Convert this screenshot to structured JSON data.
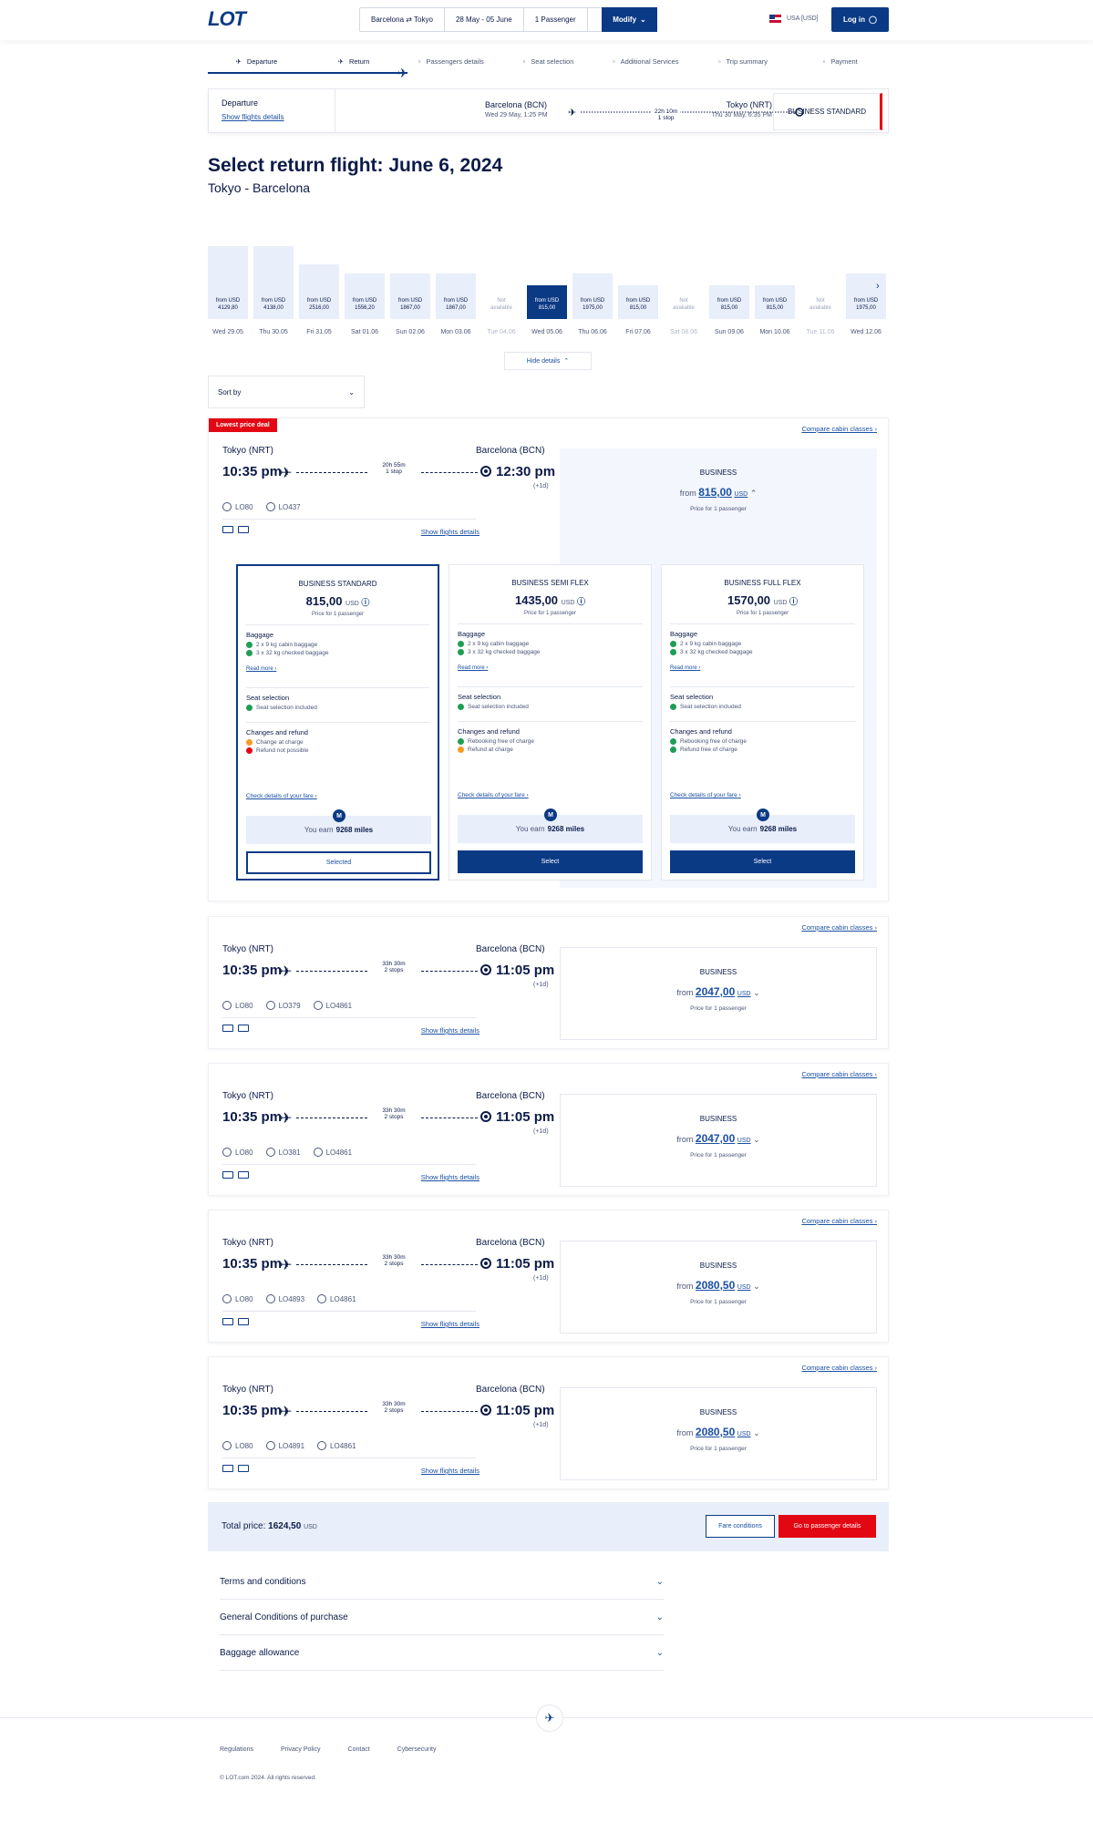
{
  "brand": {
    "logo": "LOT",
    "accent": "#0b3a85",
    "red": "#e30613"
  },
  "header": {
    "route": "Barcelona ⇄ Tokyo",
    "dates": "28 May - 05 June",
    "passengers": "1 Passenger",
    "modify": "Modify",
    "locale": "USA [USD]",
    "login": "Log in"
  },
  "steps": [
    "Departure",
    "Return",
    "Passengers details",
    "Seat selection",
    "Additional Services",
    "Trip summary",
    "Payment"
  ],
  "departure": {
    "label": "Departure",
    "link": "Show flights details",
    "from": "Barcelona (BCN)",
    "from_time": "Wed 29 May, 1:25 PM",
    "duration": "22h 10m",
    "stops": "1 stop",
    "to": "Tokyo (NRT)",
    "to_time": "Thu 30 May, 6:35 PM",
    "cabin": "BUSINESS STANDARD"
  },
  "page": {
    "title": "Select return flight: June 6, 2024",
    "subtitle": "Tokyo - Barcelona",
    "hide_details": "Hide details",
    "sort_by": "Sort by"
  },
  "dates": [
    {
      "price": "from USD\n4129,80",
      "label": "Wed 29.05",
      "h": 0.89
    },
    {
      "price": "from USD\n4138,00",
      "label": "Thu 30.05",
      "h": 0.89
    },
    {
      "price": "from USD\n2516,00",
      "label": "Fri 31.05",
      "h": 0.67
    },
    {
      "price": "from USD\n1556,20",
      "label": "Sat 01.06",
      "h": 0.56
    },
    {
      "price": "from USD\n1867,00",
      "label": "Sun 02.06",
      "h": 0.56
    },
    {
      "price": "from USD\n1867,00",
      "label": "Mon 03.06",
      "h": 0.56
    },
    {
      "price": "Not\navailable",
      "label": "Tue 04.06",
      "na": true,
      "h": 0.3
    },
    {
      "price": "from USD\n815,00",
      "label": "Wed 05.06",
      "sel": true,
      "h": 0.41
    },
    {
      "price": "from USD\n1975,00",
      "label": "Thu 06.06",
      "h": 0.56
    },
    {
      "price": "from USD\n815,00",
      "label": "Fri 07.06",
      "h": 0.41
    },
    {
      "price": "Not\navailable",
      "label": "Sat 08.06",
      "na": true,
      "h": 0.3
    },
    {
      "price": "from USD\n815,00",
      "label": "Sun 09.06",
      "h": 0.41
    },
    {
      "price": "from USD\n815,00",
      "label": "Mon 10.06",
      "h": 0.41
    },
    {
      "price": "Not\navailable",
      "label": "Tue 11.06",
      "na": true,
      "h": 0.3
    },
    {
      "price": "from USD\n1975,00",
      "label": "Wed 12.06",
      "h": 0.56
    }
  ],
  "flights": [
    {
      "lowest": "Lowest price deal",
      "from": "Tokyo (NRT)",
      "to": "Barcelona (BCN)",
      "dep": "10:35 pm",
      "arr": "12:30 pm",
      "plus": "(+1d)",
      "dur": "20h 55m",
      "stops": "1 stop",
      "nums": [
        "LO80",
        "LO437"
      ],
      "cabin": "BUSINESS",
      "price": "815,00",
      "cur": "USD",
      "pp": "Price for 1 passenger",
      "compare": "Compare cabin classes",
      "show": "Show flights details"
    },
    {
      "from": "Tokyo (NRT)",
      "to": "Barcelona (BCN)",
      "dep": "10:35 pm",
      "arr": "11:05 pm",
      "plus": "(+1d)",
      "dur": "33h 30m",
      "stops": "2 stops",
      "nums": [
        "LO80",
        "LO379",
        "LO4861"
      ],
      "cabin": "BUSINESS",
      "price": "2047,00",
      "cur": "USD",
      "pp": "Price for 1 passenger",
      "compare": "Compare cabin classes",
      "show": "Show flights details"
    },
    {
      "from": "Tokyo (NRT)",
      "to": "Barcelona (BCN)",
      "dep": "10:35 pm",
      "arr": "11:05 pm",
      "plus": "(+1d)",
      "dur": "33h 30m",
      "stops": "2 stops",
      "nums": [
        "LO80",
        "LO381",
        "LO4861"
      ],
      "cabin": "BUSINESS",
      "price": "2047,00",
      "cur": "USD",
      "pp": "Price for 1 passenger",
      "compare": "Compare cabin classes",
      "show": "Show flights details"
    },
    {
      "from": "Tokyo (NRT)",
      "to": "Barcelona (BCN)",
      "dep": "10:35 pm",
      "arr": "11:05 pm",
      "plus": "(+1d)",
      "dur": "33h 30m",
      "stops": "2 stops",
      "nums": [
        "LO80",
        "LO4893",
        "LO4861"
      ],
      "cabin": "BUSINESS",
      "price": "2080,50",
      "cur": "USD",
      "pp": "Price for 1 passenger",
      "compare": "Compare cabin classes",
      "show": "Show flights details"
    },
    {
      "from": "Tokyo (NRT)",
      "to": "Barcelona (BCN)",
      "dep": "10:35 pm",
      "arr": "11:05 pm",
      "plus": "(+1d)",
      "dur": "33h 30m",
      "stops": "2 stops",
      "nums": [
        "LO80",
        "LO4891",
        "LO4861"
      ],
      "cabin": "BUSINESS",
      "price": "2080,50",
      "cur": "USD",
      "pp": "Price for 1 passenger",
      "compare": "Compare cabin classes",
      "show": "Show flights details"
    }
  ],
  "fares": [
    {
      "name": "BUSINESS STANDARD",
      "price": "815,00",
      "cur": "USD",
      "pp": "Price for 1 passenger",
      "bag": [
        "2 x 9 kg cabin baggage",
        "3 x 32 kg checked baggage"
      ],
      "read": "Read more",
      "seat": "Seat selection included",
      "changes": [
        [
          "o",
          "Change at charge"
        ],
        [
          "r",
          "Refund not possible"
        ]
      ],
      "check": "Check details of your fare",
      "miles_pre": "You earn",
      "miles": "9268 miles",
      "btn": "Selected",
      "selected": true
    },
    {
      "name": "BUSINESS SEMI FLEX",
      "price": "1435,00",
      "cur": "USD",
      "pp": "Price for 1 passenger",
      "bag": [
        "2 x 9 kg cabin baggage",
        "3 x 32 kg checked baggage"
      ],
      "read": "Read more",
      "seat": "Seat selection included",
      "changes": [
        [
          "g",
          "Rebooking free of charge"
        ],
        [
          "o",
          "Refund at charge"
        ]
      ],
      "check": "Check details of your fare",
      "miles_pre": "You earn",
      "miles": "9268 miles",
      "btn": "Select"
    },
    {
      "name": "BUSINESS FULL FLEX",
      "price": "1570,00",
      "cur": "USD",
      "pp": "Price for 1 passenger",
      "bag": [
        "2 x 9 kg cabin baggage",
        "3 x 32 kg checked baggage"
      ],
      "read": "Read more",
      "seat": "Seat selection included",
      "changes": [
        [
          "g",
          "Rebooking free of charge"
        ],
        [
          "g",
          "Refund free of charge"
        ]
      ],
      "check": "Check details of your fare",
      "miles_pre": "You earn",
      "miles": "9268 miles",
      "btn": "Select"
    }
  ],
  "fare_labels": {
    "baggage": "Baggage",
    "seat": "Seat selection",
    "changes": "Changes and refund"
  },
  "total": {
    "label": "Total price:",
    "value": "1624,50",
    "cur": "USD",
    "fare_conditions": "Fare conditions",
    "go": "Go to passenger details"
  },
  "accordions": [
    "Terms and conditions",
    "General Conditions of purchase",
    "Baggage allowance"
  ],
  "footer": {
    "links": [
      "Regulations",
      "Privacy Policy",
      "Contact",
      "Cybersecurity"
    ],
    "copyright": "© LOT.com 2024. All rights reserved."
  }
}
